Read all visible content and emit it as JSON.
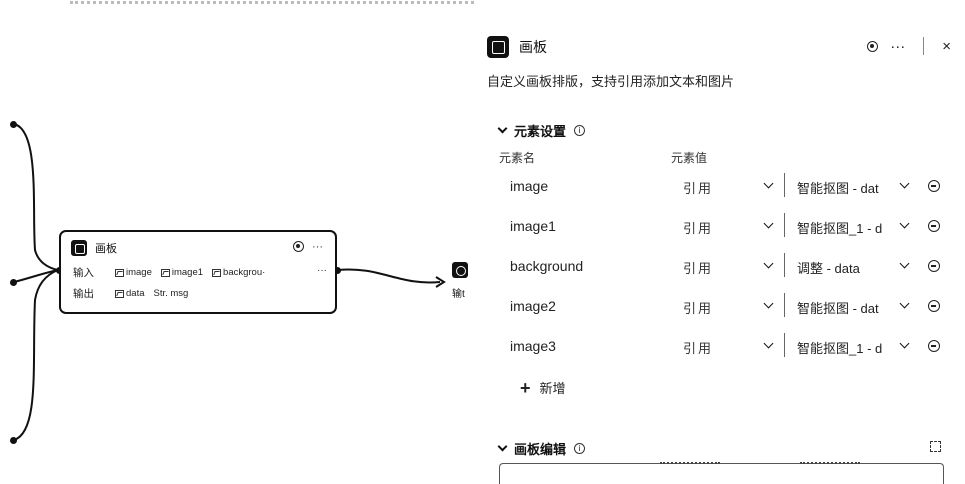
{
  "node": {
    "title": "画板",
    "input_label": "输入",
    "output_label": "输出",
    "inputs": [
      "image",
      "image1",
      "backgrou·"
    ],
    "outputs": [
      "data",
      "Str. msg"
    ],
    "more": "···"
  },
  "next_node": {
    "label": "输t"
  },
  "panel": {
    "title": "画板",
    "more": "···",
    "close": "×",
    "description": "自定义画板排版，支持引用添加文本和图片",
    "elements_section": "元素设置",
    "col_name": "元素名",
    "col_value": "元素值",
    "rows": [
      {
        "name": "image",
        "mode": "引用",
        "value": "智能抠图 - dat"
      },
      {
        "name": "image1",
        "mode": "引用",
        "value": "智能抠图_1 - d"
      },
      {
        "name": "background",
        "mode": "引用",
        "value": "调整 - data"
      },
      {
        "name": "image2",
        "mode": "引用",
        "value": "智能抠图 - dat"
      },
      {
        "name": "image3",
        "mode": "引用",
        "value": "智能抠图_1 - d"
      }
    ],
    "add_label": "新增",
    "editor_section": "画板编辑"
  },
  "icons": {
    "node_icon": "board-icon",
    "run_icon": "run-icon",
    "info_icon": "info-icon",
    "remove_icon": "remove-icon",
    "expand_icon": "expand-icon"
  }
}
